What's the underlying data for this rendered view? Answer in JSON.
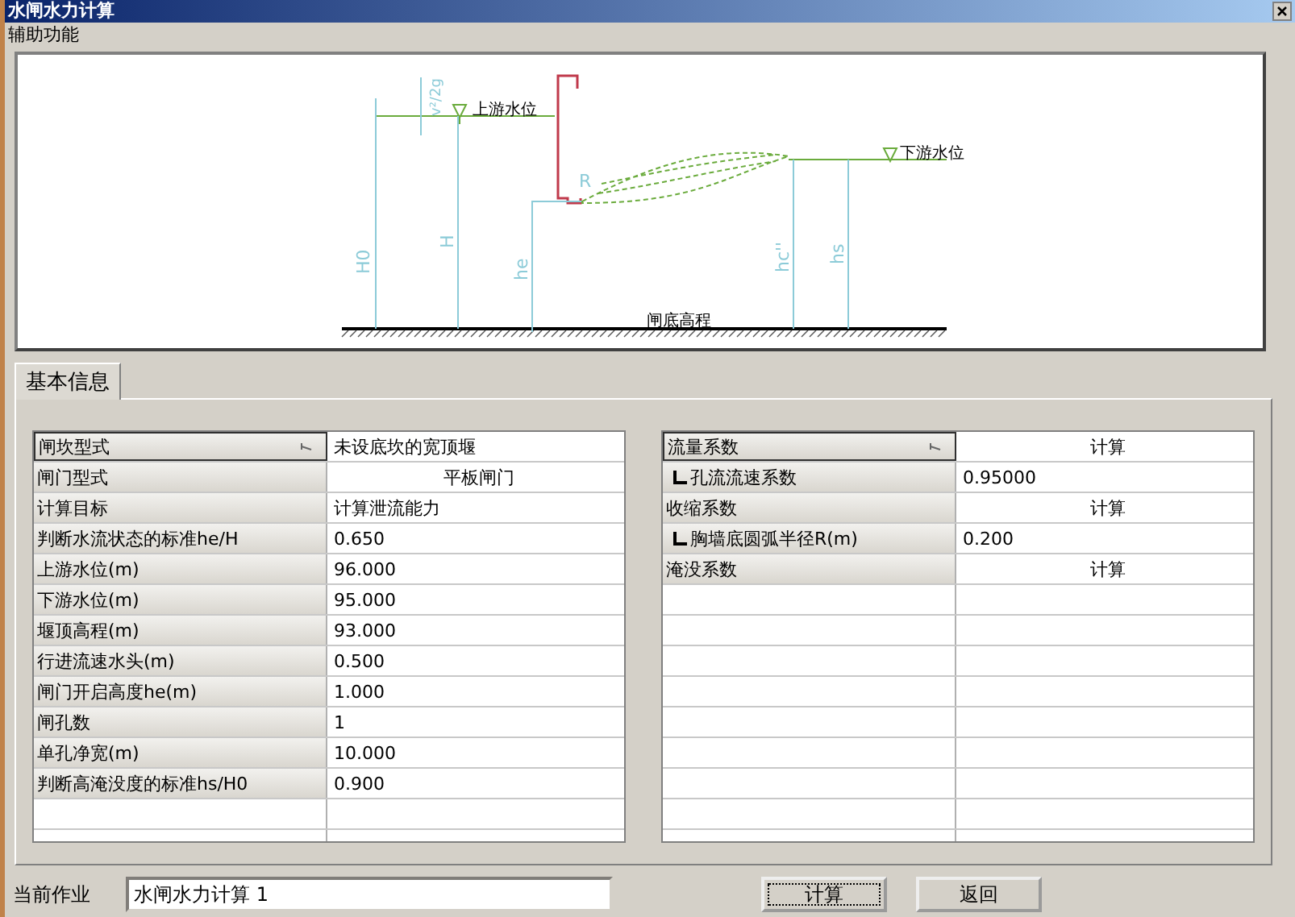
{
  "window": {
    "title": "水闸水力计算"
  },
  "menu": [
    "辅助功能"
  ],
  "diagram": {
    "upstream_label": "上游水位",
    "downstream_label": "下游水位",
    "bed_label": "闸底高程",
    "dimension_labels": [
      "v²/2g",
      "H0",
      "H",
      "he",
      "hc''",
      "hs",
      "R"
    ]
  },
  "tabs": [
    {
      "label": "基本信息",
      "selected": true
    }
  ],
  "left_table": {
    "rows": [
      {
        "label": "闸坎型式",
        "value": "未设底坎的宽顶堰",
        "kind": "text",
        "selected": true
      },
      {
        "label": "闸门型式",
        "value": "平板闸门",
        "kind": "option",
        "selected": false
      },
      {
        "label": "计算目标",
        "value": "计算泄流能力",
        "kind": "text",
        "selected": false
      },
      {
        "label": "判断水流状态的标准he/H",
        "value": "0.650",
        "kind": "text",
        "selected": false
      },
      {
        "label": "上游水位(m)",
        "value": "96.000",
        "kind": "text",
        "selected": false
      },
      {
        "label": "下游水位(m)",
        "value": "95.000",
        "kind": "text",
        "selected": false
      },
      {
        "label": "堰顶高程(m)",
        "value": "93.000",
        "kind": "text",
        "selected": false
      },
      {
        "label": "行进流速水头(m)",
        "value": "0.500",
        "kind": "text",
        "selected": false
      },
      {
        "label": "闸门开启高度he(m)",
        "value": "1.000",
        "kind": "text",
        "selected": false
      },
      {
        "label": "闸孔数",
        "value": "1",
        "kind": "text",
        "selected": false
      },
      {
        "label": "单孔净宽(m)",
        "value": "10.000",
        "kind": "text",
        "selected": false
      },
      {
        "label": "判断高淹没度的标准hs/H0",
        "value": "0.900",
        "kind": "text",
        "selected": false
      }
    ]
  },
  "right_table": {
    "rows": [
      {
        "label": "流量系数",
        "value": "计算",
        "kind": "option",
        "selected": true,
        "children": [
          {
            "label": "孔流流速系数",
            "value": "0.95000",
            "kind": "text",
            "selected": false
          }
        ]
      },
      {
        "label": "收缩系数",
        "value": "计算",
        "kind": "option",
        "selected": false,
        "children": [
          {
            "label": "胸墙底圆弧半径R(m)",
            "value": "0.200",
            "kind": "text",
            "selected": false
          }
        ]
      },
      {
        "label": "淹没系数",
        "value": "计算",
        "kind": "option",
        "selected": false
      }
    ]
  },
  "footer": {
    "job_label": "当前作业",
    "job_value": "水闸水力计算 1",
    "buttons": [
      {
        "label": "计算",
        "focused": true
      },
      {
        "label": "返回",
        "focused": false
      }
    ]
  }
}
